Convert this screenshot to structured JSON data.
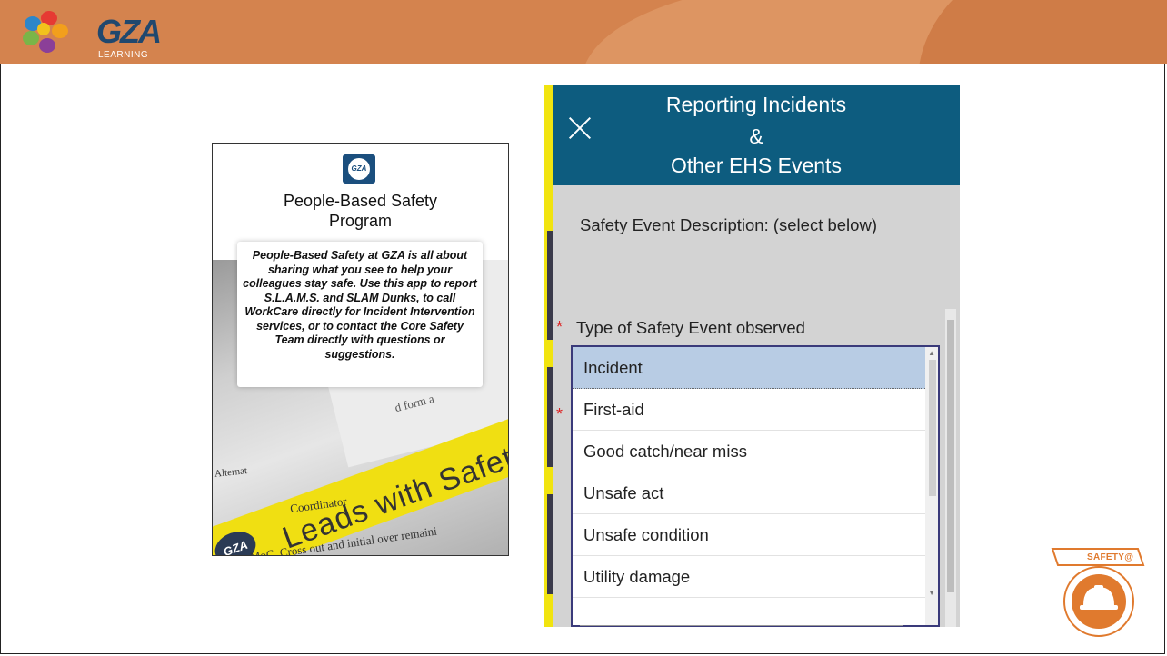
{
  "header": {
    "logo_text": "GZA",
    "logo_subtext": "LEARNING"
  },
  "phone_card": {
    "app_icon_text": "GZA",
    "title_line1": "People-Based Safety",
    "title_line2": "Program",
    "blurb": "People-Based Safety at GZA is all about sharing what you see to help your colleagues stay safe. Use this app to report S.L.A.M.S. and SLAM Dunks, to call WorkCare directly for Incident Intervention services, or to contact the Core Safety Team directly with questions or suggestions.",
    "photo": {
      "band_text": "Leads with Safety",
      "band_logo": "GZA",
      "coordinator_text": "Coordinator",
      "bottom_text": "MoC. Cross out and initial over remaini",
      "paper_text": "d form a",
      "alt_text": "Alternat"
    }
  },
  "form": {
    "title_line1": "Reporting Incidents",
    "title_line2": "&",
    "title_line3": "Other EHS Events",
    "description_label": "Safety Event Description: (select below)",
    "field_label": "Type of Safety Event observed",
    "required_mark": "*",
    "options": [
      "Incident",
      "First-aid",
      "Good catch/near miss",
      "Unsafe act",
      "Unsafe condition",
      "Utility damage"
    ],
    "selected_option": "Incident"
  },
  "badge": {
    "label": "SAFETY@"
  },
  "colors": {
    "topbar": "#d4834e",
    "form_header": "#0d5c7f",
    "selected_option": "#b8cce4",
    "badge_orange": "#e07a2e"
  }
}
